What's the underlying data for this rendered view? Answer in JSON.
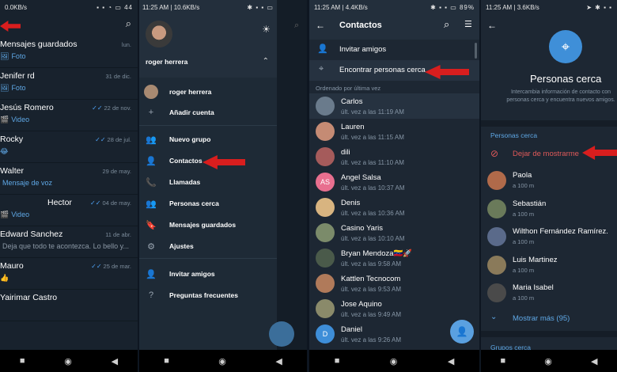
{
  "panel1": {
    "status_left": "0.0KB/s",
    "status_right": "44",
    "chats": [
      {
        "name": "Mensajes guardados",
        "date": "lun.",
        "sub": "Foto",
        "icon": "🖼",
        "ticks": ""
      },
      {
        "name": "Jenifer rd",
        "date": "31 de dic.",
        "sub": "Foto",
        "icon": "🖼",
        "ticks": ""
      },
      {
        "name": "Jesús Romero",
        "date": "22 de nov.",
        "sub": "Video",
        "icon": "🎬",
        "ticks": "✓✓"
      },
      {
        "name": "Rocky",
        "date": "28 de jul.",
        "sub": "",
        "icon": "😂",
        "ticks": "✓✓"
      },
      {
        "name": "Walter",
        "date": "29 de may.",
        "sub": "Mensaje de voz",
        "icon": "",
        "ticks": ""
      },
      {
        "name": "Hector",
        "date": "04 de may.",
        "sub": "Video",
        "icon": "🎬",
        "ticks": "✓✓"
      },
      {
        "name": "Edward Sanchez",
        "date": "11 de abr.",
        "sub": "Deja que todo te acontezca. Lo bello y...",
        "icon": "",
        "ticks": ""
      },
      {
        "name": "Mauro",
        "date": "25 de mar.",
        "sub": "",
        "icon": "👍",
        "ticks": "✓✓"
      },
      {
        "name": "Yairimar Castro",
        "date": "",
        "sub": "",
        "icon": "",
        "ticks": ""
      }
    ]
  },
  "panel2": {
    "status_left": "11:25 AM | 10.6KB/s",
    "status_right": "",
    "user_name": "roger herrera",
    "account_name": "roger herrera",
    "add_account": "Añadir cuenta",
    "items": [
      {
        "label": "Nuevo grupo",
        "icon": "group-icon",
        "glyph": "👥"
      },
      {
        "label": "Contactos",
        "icon": "person-icon",
        "glyph": "👤"
      },
      {
        "label": "Llamadas",
        "icon": "phone-icon",
        "glyph": "📞"
      },
      {
        "label": "Personas cerca",
        "icon": "people-nearby-icon",
        "glyph": "👥"
      },
      {
        "label": "Mensajes guardados",
        "icon": "bookmark-icon",
        "glyph": "🔖"
      },
      {
        "label": "Ajustes",
        "icon": "gear-icon",
        "glyph": "⚙"
      },
      {
        "label": "Invitar amigos",
        "icon": "invite-icon",
        "glyph": "👤"
      },
      {
        "label": "Preguntas frecuentes",
        "icon": "help-icon",
        "glyph": "?"
      }
    ]
  },
  "panel3": {
    "status_left": "11:25 AM | 4.4KB/s",
    "status_right": "89%",
    "title": "Contactos",
    "invite": "Invitar amigos",
    "find_nearby": "Encontrar personas cerca",
    "sort_label": "Ordenado por última vez",
    "contacts": [
      {
        "name": "Carlos",
        "seen": "últ. vez a las 11:19 AM",
        "color": "#6a7b8c",
        "initial": ""
      },
      {
        "name": "Lauren",
        "seen": "últ. vez a las 11:15 AM",
        "color": "#c58b74",
        "initial": ""
      },
      {
        "name": "dili",
        "seen": "últ. vez a las 11:10 AM",
        "color": "#a55b5b",
        "initial": ""
      },
      {
        "name": "Angel Salsa",
        "seen": "últ. vez a las 10:37 AM",
        "color": "#e86f8f",
        "initial": "AS"
      },
      {
        "name": "Denis",
        "seen": "últ. vez a las 10:36 AM",
        "color": "#d8b480",
        "initial": ""
      },
      {
        "name": "Casino Yaris",
        "seen": "últ. vez a las 10:10 AM",
        "color": "#7b8b6a",
        "initial": ""
      },
      {
        "name": "Bryan Mendoza🇻🇪🚀",
        "seen": "últ. vez a las 9:58 AM",
        "color": "#4a5a4a",
        "initial": ""
      },
      {
        "name": "Kattlen Tecnocom",
        "seen": "últ. vez a las 9:53 AM",
        "color": "#b07a5a",
        "initial": ""
      },
      {
        "name": "Jose Aquino",
        "seen": "últ. vez a las 9:49 AM",
        "color": "#8a8a6a",
        "initial": ""
      },
      {
        "name": "Daniel",
        "seen": "últ. vez a las 9:26 AM",
        "color": "#3e8ed8",
        "initial": "D"
      }
    ]
  },
  "panel4": {
    "status_left": "11:25 AM | 3.6KB/s",
    "title": "Personas cerca",
    "description": "Intercambia información de contacto con personas cerca y encuentra nuevos amigos.",
    "section": "Personas cerca",
    "stop_showing": "Dejar de mostrarme",
    "people": [
      {
        "name": "Paola",
        "dist": "a 100 m",
        "color": "#b06a4a"
      },
      {
        "name": "Sebastián",
        "dist": "a 100 m",
        "color": "#6a7a5a"
      },
      {
        "name": "Wilthon Fernández Ramírez.",
        "dist": "a 100 m",
        "color": "#5a6a8a"
      },
      {
        "name": "Luis Martinez",
        "dist": "a 100 m",
        "color": "#8a7a5a"
      },
      {
        "name": "Maria Isabel",
        "dist": "a 100 m",
        "color": "#4a4a4a"
      }
    ],
    "show_more": "Mostrar más (95)",
    "groups": "Grupos cerca"
  },
  "colors": {
    "accent": "#5fa8e6",
    "arrow": "#e02020",
    "danger": "#e05a5a"
  }
}
